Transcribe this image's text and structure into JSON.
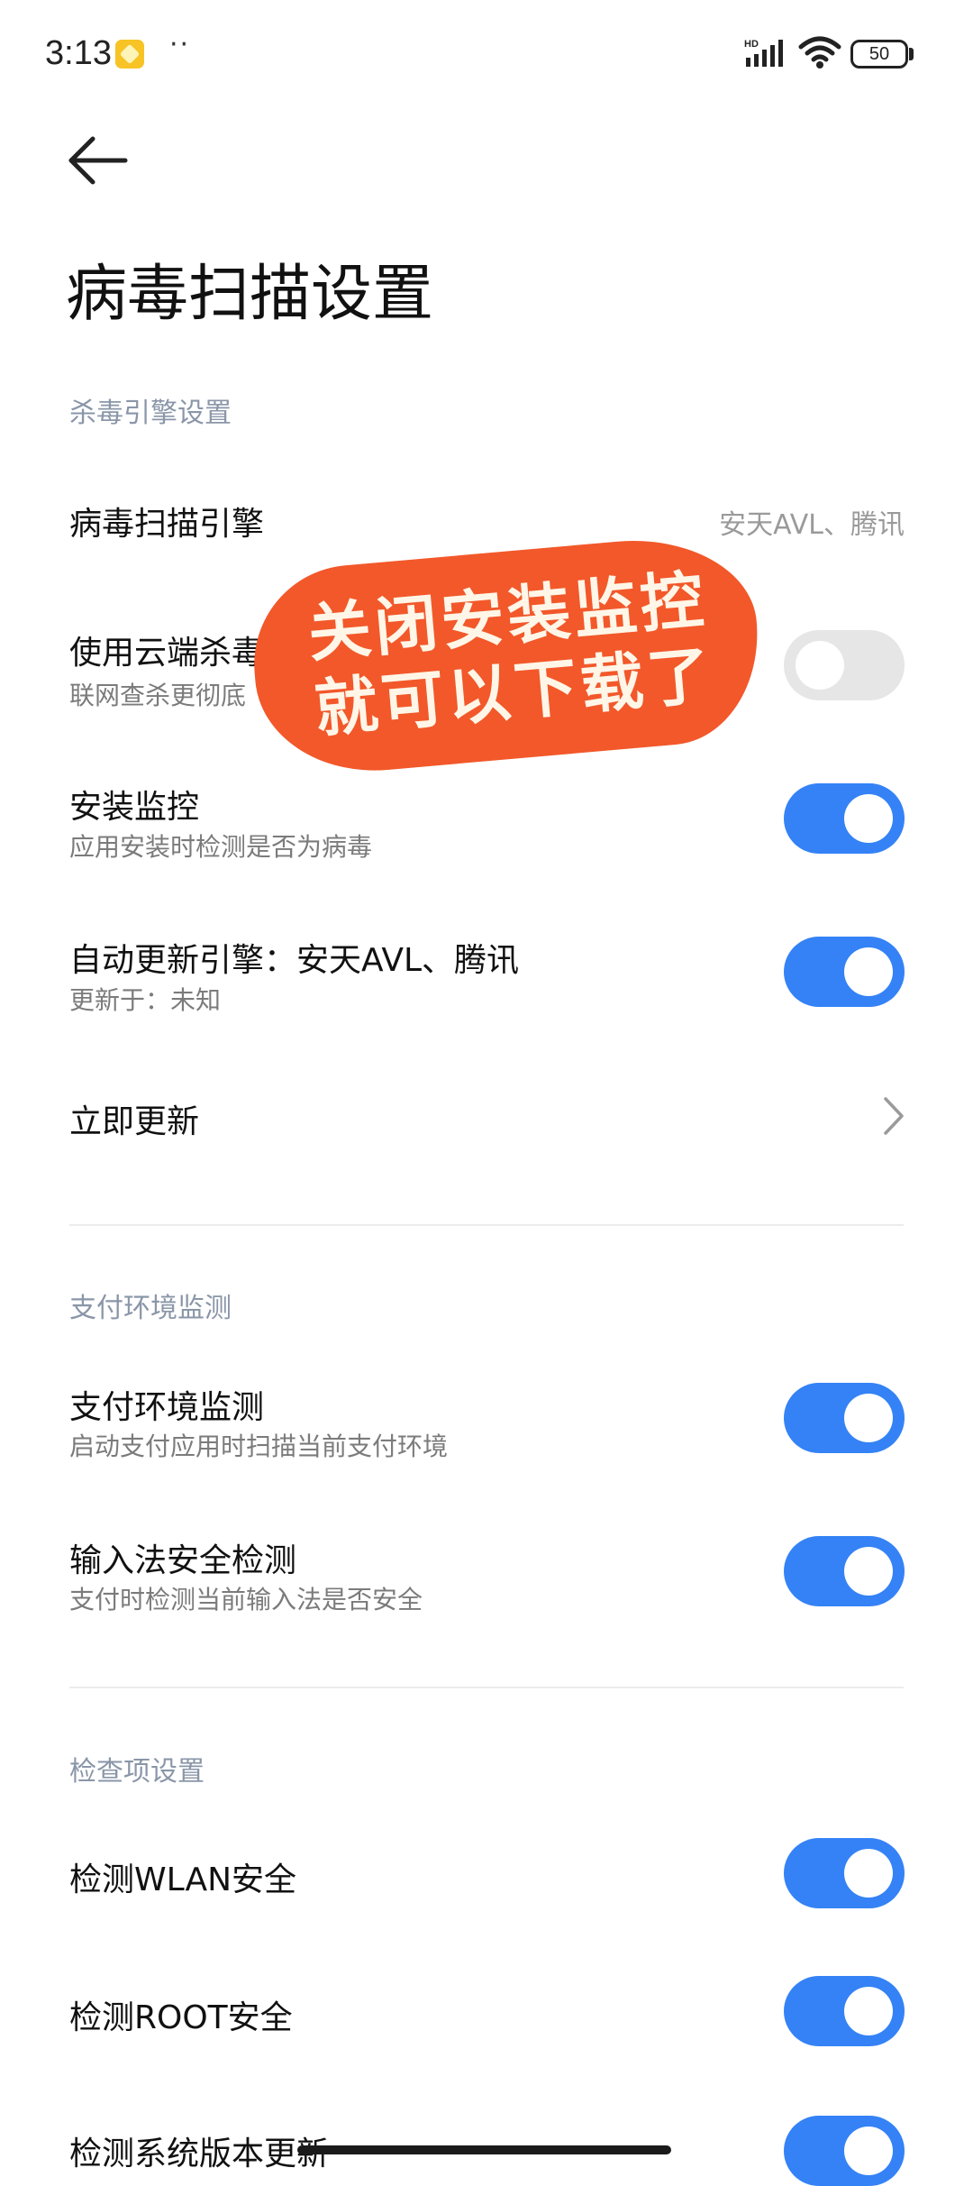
{
  "status_bar": {
    "time": "3:13",
    "dots": "··",
    "hd": "HD",
    "battery": "50"
  },
  "header": {
    "title": "病毒扫描设置"
  },
  "sections": {
    "engine": {
      "label": "杀毒引擎设置",
      "scan_engine": {
        "title": "病毒扫描引擎",
        "value": "安天AVL、腾讯"
      },
      "cloud": {
        "title": "使用云端杀毒",
        "subtitle": "联网查杀更彻底",
        "enabled": false
      },
      "install_monitor": {
        "title": "安装监控",
        "subtitle": "应用安装时检测是否为病毒",
        "enabled": true
      },
      "auto_update": {
        "title": "自动更新引擎：安天AVL、腾讯",
        "subtitle": "更新于：未知",
        "enabled": true
      },
      "update_now": {
        "title": "立即更新"
      }
    },
    "payment": {
      "label": "支付环境监测",
      "payment_monitor": {
        "title": "支付环境监测",
        "subtitle": "启动支付应用时扫描当前支付环境",
        "enabled": true
      },
      "ime_check": {
        "title": "输入法安全检测",
        "subtitle": "支付时检测当前输入法是否安全",
        "enabled": true
      }
    },
    "checks": {
      "label": "检查项设置",
      "wlan": {
        "title": "检测WLAN安全",
        "enabled": true
      },
      "root": {
        "title": "检测ROOT安全",
        "enabled": true
      },
      "system_update": {
        "title": "检测系统版本更新",
        "enabled": true
      }
    }
  },
  "overlay": {
    "line1": "关闭安装监控",
    "line2": "就可以下载了"
  },
  "colors": {
    "accent": "#3482f6",
    "sticker": "#f2582a",
    "section_label": "#8a96a8"
  }
}
